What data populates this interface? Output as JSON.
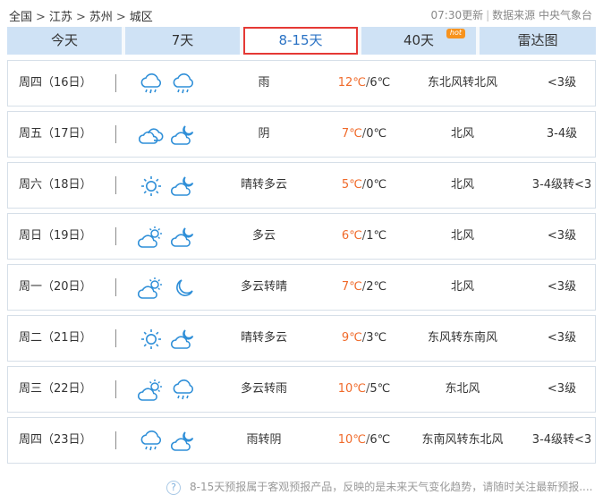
{
  "breadcrumb": [
    "全国",
    "江苏",
    "苏州",
    "城区"
  ],
  "breadcrumb_sep": ">",
  "update_time": "07:30更新",
  "source_label": "数据来源 中央气象台",
  "tabs": [
    {
      "label": "今天",
      "active": false
    },
    {
      "label": "7天",
      "active": false
    },
    {
      "label": "8-15天",
      "active": true
    },
    {
      "label": "40天",
      "active": false,
      "badge": "hot"
    },
    {
      "label": "雷达图",
      "active": false
    }
  ],
  "days": [
    {
      "date": "周四（16日）",
      "icons": [
        "rain-icon",
        "rain-icon"
      ],
      "desc": "雨",
      "high": "12℃",
      "low": "6℃",
      "wind": "东北风转北风",
      "level": "<3级"
    },
    {
      "date": "周五（17日）",
      "icons": [
        "overcast-icon",
        "cloudy-night-icon"
      ],
      "desc": "阴",
      "high": "7℃",
      "low": "0℃",
      "wind": "北风",
      "level": "3-4级"
    },
    {
      "date": "周六（18日）",
      "icons": [
        "sunny-icon",
        "cloudy-night-icon"
      ],
      "desc": "晴转多云",
      "high": "5℃",
      "low": "0℃",
      "wind": "北风",
      "level": "3-4级转<3"
    },
    {
      "date": "周日（19日）",
      "icons": [
        "partly-cloudy-icon",
        "cloudy-night-icon"
      ],
      "desc": "多云",
      "high": "6℃",
      "low": "1℃",
      "wind": "北风",
      "level": "<3级"
    },
    {
      "date": "周一（20日）",
      "icons": [
        "partly-cloudy-icon",
        "moon-icon"
      ],
      "desc": "多云转晴",
      "high": "7℃",
      "low": "2℃",
      "wind": "北风",
      "level": "<3级"
    },
    {
      "date": "周二（21日）",
      "icons": [
        "sunny-icon",
        "cloudy-night-icon"
      ],
      "desc": "晴转多云",
      "high": "9℃",
      "low": "3℃",
      "wind": "东风转东南风",
      "level": "<3级"
    },
    {
      "date": "周三（22日）",
      "icons": [
        "partly-cloudy-icon",
        "rain-icon"
      ],
      "desc": "多云转雨",
      "high": "10℃",
      "low": "5℃",
      "wind": "东北风",
      "level": "<3级"
    },
    {
      "date": "周四（23日）",
      "icons": [
        "rain-icon",
        "cloudy-night-icon"
      ],
      "desc": "雨转阴",
      "high": "10℃",
      "low": "6℃",
      "wind": "东南风转东北风",
      "level": "3-4级转<3"
    }
  ],
  "footer_note": "8-15天预报属于客观预报产品，反映的是未来天气变化趋势，请随时关注最新预报....",
  "colors": {
    "accent": "#2a72c4",
    "tab_bg": "#cfe2f5",
    "active_border": "#e53935",
    "high_temp": "#f06a2a",
    "icon_stroke": "#2f8fd8",
    "hot_badge": "#f7931e"
  }
}
